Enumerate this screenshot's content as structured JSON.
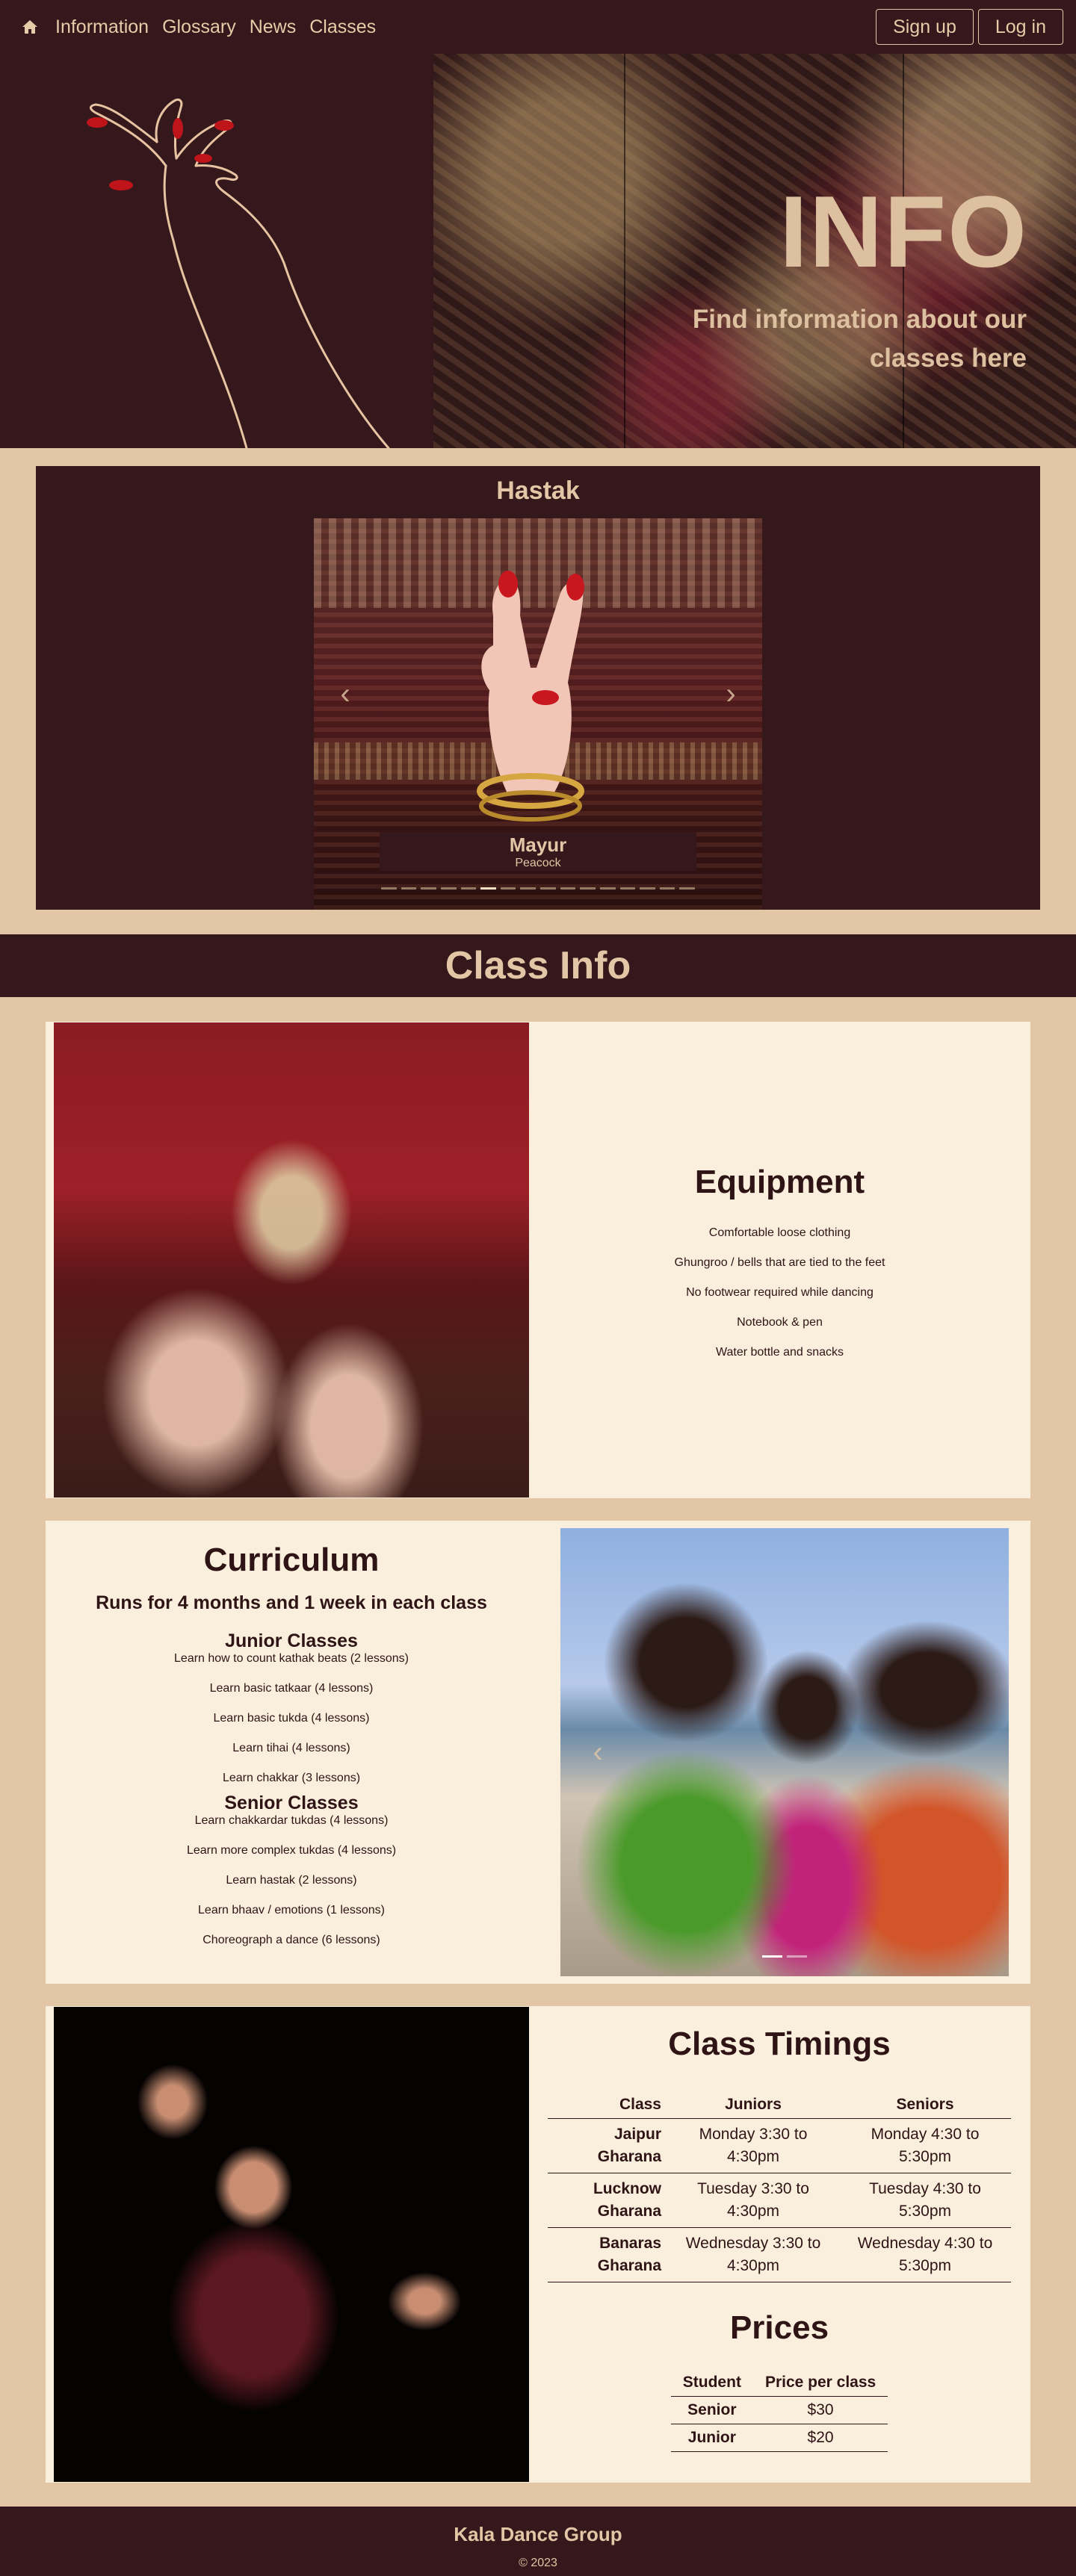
{
  "nav": {
    "home_icon": "home-icon",
    "links": [
      "Information",
      "Glossary",
      "News",
      "Classes"
    ],
    "signup_label": "Sign up",
    "login_label": "Log in"
  },
  "hero": {
    "title": "INFO",
    "subtitle": "Find information about our classes here"
  },
  "hastak": {
    "title": "Hastak",
    "slide_title": "Mayur",
    "slide_subtitle": "Peacock",
    "slide_count": 16,
    "active_slide": 5
  },
  "class_info": {
    "banner": "Class Info"
  },
  "equipment": {
    "title": "Equipment",
    "items": [
      "Comfortable loose clothing",
      "Ghungroo / bells that are tied to the feet",
      "No footwear required while dancing",
      "Notebook & pen",
      "Water bottle and snacks"
    ]
  },
  "curriculum": {
    "title": "Curriculum",
    "duration": "Runs for 4 months and 1 week in each class",
    "junior_title": "Junior Classes",
    "junior_items": [
      "Learn how to count kathak beats (2 lessons)",
      "Learn basic tatkaar (4 lessons)",
      "Learn basic tukda (4 lessons)",
      "Learn tihai (4 lessons)",
      "Learn chakkar (3 lessons)"
    ],
    "senior_title": "Senior Classes",
    "senior_items": [
      "Learn chakkardar tukdas (4 lessons)",
      "Learn more complex tukdas (4 lessons)",
      "Learn hastak (2 lessons)",
      "Learn bhaav / emotions (1 lessons)",
      "Choreograph a dance (6 lessons)"
    ]
  },
  "timings": {
    "title": "Class Timings",
    "headers": [
      "Class",
      "Juniors",
      "Seniors"
    ],
    "rows": [
      [
        "Jaipur Gharana",
        "Monday 3:30 to 4:30pm",
        "Monday 4:30 to 5:30pm"
      ],
      [
        "Lucknow Gharana",
        "Tuesday 3:30 to 4:30pm",
        "Tuesday 4:30 to 5:30pm"
      ],
      [
        "Banaras Gharana",
        "Wednesday 3:30 to 4:30pm",
        "Wednesday 4:30 to 5:30pm"
      ]
    ]
  },
  "prices": {
    "title": "Prices",
    "headers": [
      "Student",
      "Price per class"
    ],
    "rows": [
      [
        "Senior",
        "$30"
      ],
      [
        "Junior",
        "$20"
      ]
    ]
  },
  "footer": {
    "title": "Kala Dance Group",
    "copyright": "© 2023"
  },
  "colors": {
    "dark": "#34181b",
    "sand": "#e2c6a5",
    "cream": "#faeedd"
  }
}
